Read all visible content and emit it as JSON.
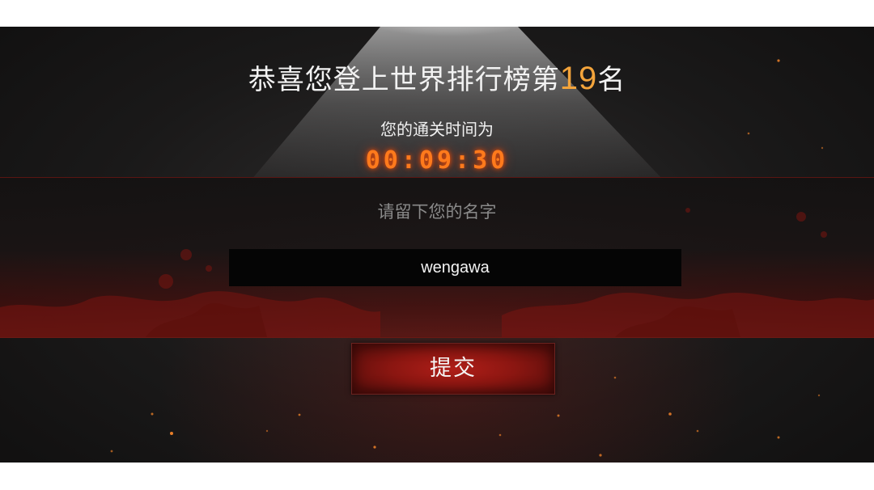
{
  "result": {
    "title_prefix": "恭喜您登上世界排行榜第",
    "rank": "19",
    "title_suffix": "名",
    "time_label": "您的通关时间为",
    "clear_time": "00:09:30"
  },
  "form": {
    "name_prompt": "请留下您的名字",
    "name_value": "wengawa",
    "submit_label": "提交"
  },
  "colors": {
    "rank_accent": "#f3a43b",
    "timer": "#ff7a1c",
    "button_red": "#a81b15",
    "input_bg": "#050505"
  }
}
